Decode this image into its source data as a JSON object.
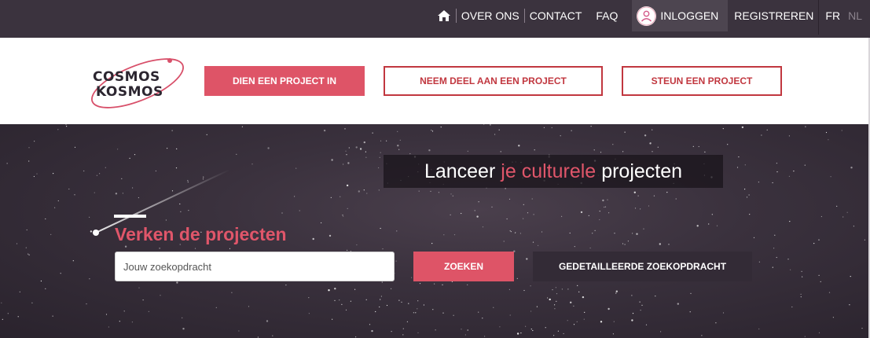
{
  "nav": {
    "home_icon": "home-icon",
    "links": [
      "OVER ONS",
      "CONTACT",
      "FAQ"
    ],
    "login": "INLOGGEN",
    "user_icon": "user-icon",
    "register": "REGISTREREN",
    "languages": [
      "FR",
      "NL"
    ]
  },
  "logo": {
    "line1": "COSMOS",
    "line2": "KOSMOS"
  },
  "header": {
    "submit_project": "DIEN EEN PROJECT IN",
    "join_project": "NEEM DEEL AAN EEN PROJECT",
    "support_project": "STEUN EEN PROJECT"
  },
  "hero": {
    "tagline": {
      "part1": "Lanceer",
      "accent": "je culturele",
      "part2": "projecten"
    },
    "explore_title": "Verken de projecten",
    "search_placeholder": "Jouw zoekopdracht",
    "search_button": "ZOEKEN",
    "advanced_search_button": "GEDETAILLEERDE ZOEKOPDRACHT"
  },
  "colors": {
    "accent": "#de5467",
    "outline": "#c1373f",
    "topbar": "#3b333e",
    "hero": "#2e2631"
  }
}
